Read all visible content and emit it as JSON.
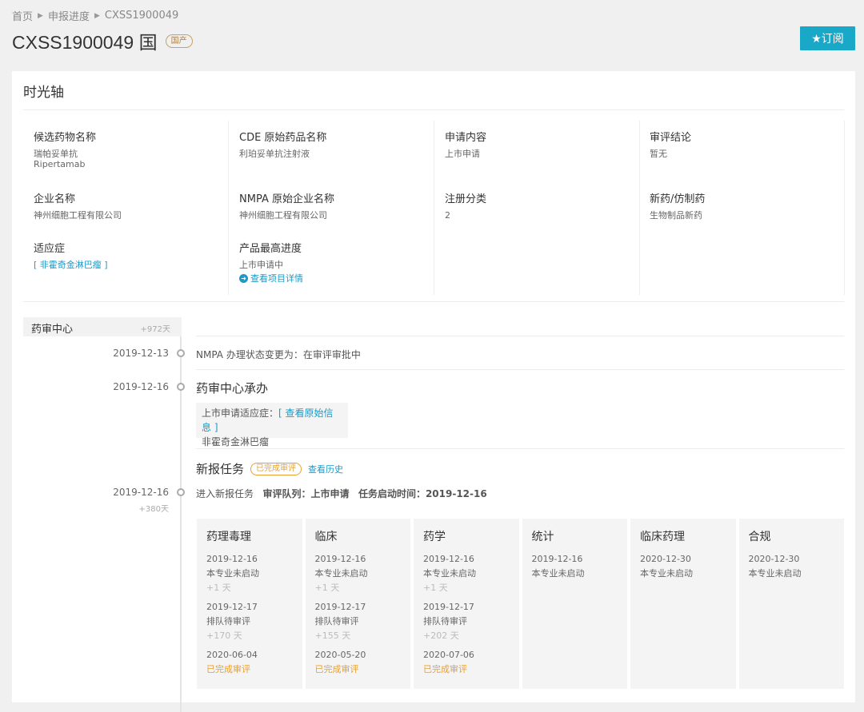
{
  "breadcrumb": {
    "home": "首页",
    "progress": "申报进度",
    "current": "CXSS1900049"
  },
  "title": "CXSS1900049 国",
  "origin_badge": "国产",
  "subscribe_label": "★订阅",
  "card_title": "时光轴",
  "info": {
    "candidate_label": "候选药物名称",
    "candidate_cn": "瑞帕妥单抗",
    "candidate_en": "Ripertamab",
    "cde_label": "CDE 原始药品名称",
    "cde_value": "利珀妥单抗注射液",
    "apply_label": "申请内容",
    "apply_value": "上市申请",
    "review_label": "审评结论",
    "review_value": "暂无",
    "company_label": "企业名称",
    "company_value": "神州细胞工程有限公司",
    "nmpa_label": "NMPA 原始企业名称",
    "nmpa_value": "神州细胞工程有限公司",
    "reg_label": "注册分类",
    "reg_value": "2",
    "type_label": "新药/仿制药",
    "type_value": "生物制品新药",
    "indication_label": "适应症",
    "indication_value": "[ 非霍奇金淋巴瘤 ]",
    "progress_label": "产品最高进度",
    "progress_value": "上市申请中",
    "progress_link": "查看项目详情"
  },
  "timeline": {
    "center": "药审中心",
    "center_days": "+972天",
    "e1_date": "2019-12-13",
    "e1_text": "NMPA 办理状态变更为：在审评审批中",
    "e2_date": "2019-12-16",
    "e2_title": "药审中心承办",
    "e2_box_prefix": "上市申请适应症：",
    "e2_box_link": "[ 查看原始信息 ]",
    "e2_box_value": "非霍奇金淋巴瘤",
    "task_title": "新报任务",
    "task_tag": "已完成审评",
    "task_history": "查看历史",
    "e3_date": "2019-12-16",
    "e3_plus": "+380天",
    "e3_text": "进入新报任务",
    "e3_queue": "审评队列：上市申请",
    "e3_start": "任务启动时间：2019-12-16"
  },
  "disciplines": [
    {
      "name": "药理毒理",
      "entries": [
        {
          "date": "2019-12-16",
          "status": "本专业未启动",
          "days": "+1 天",
          "done": false
        },
        {
          "date": "2019-12-17",
          "status": "排队待审评",
          "days": "+170 天",
          "done": false
        },
        {
          "date": "2020-06-04",
          "status": "已完成审评",
          "days": "",
          "done": true
        }
      ]
    },
    {
      "name": "临床",
      "entries": [
        {
          "date": "2019-12-16",
          "status": "本专业未启动",
          "days": "+1 天",
          "done": false
        },
        {
          "date": "2019-12-17",
          "status": "排队待审评",
          "days": "+155 天",
          "done": false
        },
        {
          "date": "2020-05-20",
          "status": "已完成审评",
          "days": "",
          "done": true
        }
      ]
    },
    {
      "name": "药学",
      "entries": [
        {
          "date": "2019-12-16",
          "status": "本专业未启动",
          "days": "+1 天",
          "done": false
        },
        {
          "date": "2019-12-17",
          "status": "排队待审评",
          "days": "+202 天",
          "done": false
        },
        {
          "date": "2020-07-06",
          "status": "已完成审评",
          "days": "",
          "done": true
        }
      ]
    },
    {
      "name": "统计",
      "entries": [
        {
          "date": "2019-12-16",
          "status": "本专业未启动",
          "days": "",
          "done": false
        }
      ]
    },
    {
      "name": "临床药理",
      "entries": [
        {
          "date": "2020-12-30",
          "status": "本专业未启动",
          "days": "",
          "done": false
        }
      ]
    },
    {
      "name": "合规",
      "entries": [
        {
          "date": "2020-12-30",
          "status": "本专业未启动",
          "days": "",
          "done": false
        }
      ]
    }
  ],
  "colors": {
    "accent": "#1aa8c8",
    "link": "#1a9ac8",
    "done": "#e8a030"
  }
}
